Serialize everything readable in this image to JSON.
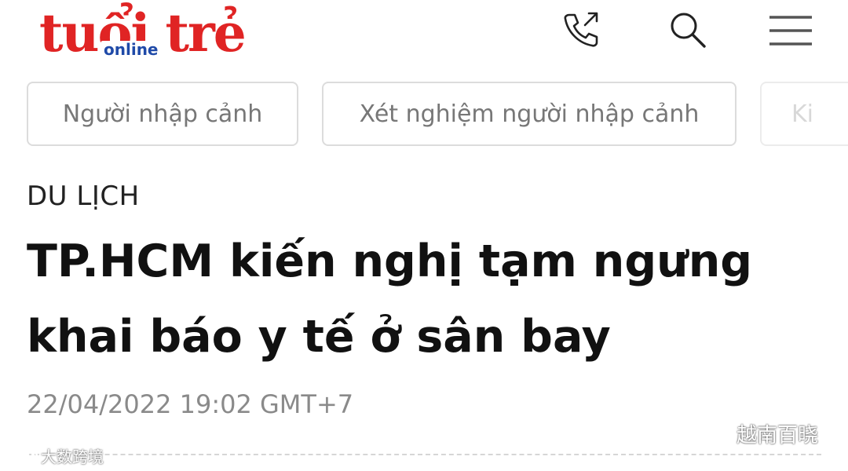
{
  "header": {
    "logo_main": "tuổi trẻ",
    "logo_sub": "online",
    "brand_colors": {
      "logo_red": "#e02424",
      "logo_blue": "#1f4aa8"
    },
    "icons": [
      "phone-icon",
      "search-icon",
      "hamburger-menu-icon"
    ]
  },
  "tags": [
    {
      "label": "Người nhập cảnh"
    },
    {
      "label": "Xét nghiệm người nhập cảnh"
    },
    {
      "label": "Ki"
    }
  ],
  "article": {
    "category": "DU LỊCH",
    "title": "TP.HCM kiến nghị tạm ngưng khai báo y tế ở sân bay",
    "timestamp": "22/04/2022 19:02 GMT+7"
  },
  "watermarks": {
    "left": "大数跨境",
    "right": "越南百晓"
  }
}
